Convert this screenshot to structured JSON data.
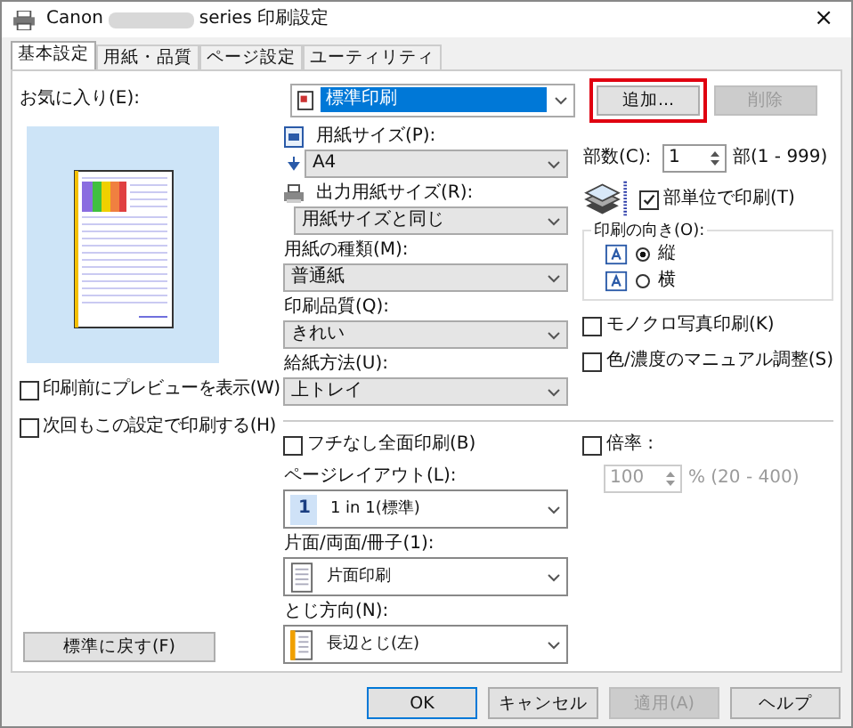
{
  "window": {
    "title_prefix": "Canon",
    "title_suffix": "series 印刷設定",
    "close": "×"
  },
  "tabs": [
    {
      "label": "基本設定",
      "selected": true
    },
    {
      "label": "用紙・品質",
      "selected": false
    },
    {
      "label": "ページ設定",
      "selected": false
    },
    {
      "label": "ユーティリティ",
      "selected": false
    }
  ],
  "favorites": {
    "label": "お気に入り(E):",
    "value": "標準印刷",
    "buttons": [
      {
        "label": "追加...",
        "disabled": false,
        "highlighted": true
      },
      {
        "label": "削除",
        "disabled": true,
        "highlighted": false
      }
    ]
  },
  "left": {
    "checkboxes": [
      {
        "label": "印刷前にプレビューを表示(W)",
        "checked": false
      },
      {
        "label": "次回もこの設定で印刷する(H)",
        "checked": false
      }
    ],
    "reset_button": "標準に戻す(F)"
  },
  "fields_top": [
    {
      "label": "用紙サイズ(P):",
      "value": "A4",
      "kind": "paper"
    },
    {
      "label": "出力用紙サイズ(R):",
      "value": "用紙サイズと同じ",
      "kind": "output"
    },
    {
      "label": "用紙の種類(M):",
      "value": "普通紙",
      "kind": "plain"
    },
    {
      "label": "印刷品質(Q):",
      "value": "きれい",
      "kind": "plain"
    },
    {
      "label": "給紙方法(U):",
      "value": "上トレイ",
      "kind": "plain"
    }
  ],
  "copies": {
    "label": "部数(C):",
    "value": "1",
    "range": "部(1 - 999)"
  },
  "collate": {
    "label": "部単位で印刷(T)",
    "checked": true
  },
  "orientation": {
    "label": "印刷の向き(O):",
    "options": [
      {
        "label": "縦",
        "selected": true
      },
      {
        "label": "横",
        "selected": false
      }
    ]
  },
  "right_checks": [
    {
      "label": "モノクロ写真印刷(K)",
      "checked": false
    },
    {
      "label": "色/濃度のマニュアル調整(S)",
      "checked": false
    }
  ],
  "borderless": {
    "label": "フチなし全面印刷(B)",
    "checked": false
  },
  "layout_fields": [
    {
      "label": "ページレイアウト(L):",
      "value": "1 in 1(標準)",
      "kind": "number",
      "badge": "1"
    },
    {
      "label": "片面/両面/冊子(1):",
      "value": "片面印刷",
      "kind": "page"
    },
    {
      "label": "とじ方向(N):",
      "value": "長辺とじ(左)",
      "kind": "binding"
    }
  ],
  "scale": {
    "label": "倍率 :",
    "checked": false,
    "value": "100",
    "range": "% (20 - 400)",
    "disabled": true
  },
  "footer_buttons": [
    {
      "label": "OK",
      "default": true,
      "disabled": false
    },
    {
      "label": "キャンセル",
      "default": false,
      "disabled": false
    },
    {
      "label": "適用(A)",
      "default": false,
      "disabled": true
    },
    {
      "label": "ヘルプ",
      "default": false,
      "disabled": false
    }
  ]
}
